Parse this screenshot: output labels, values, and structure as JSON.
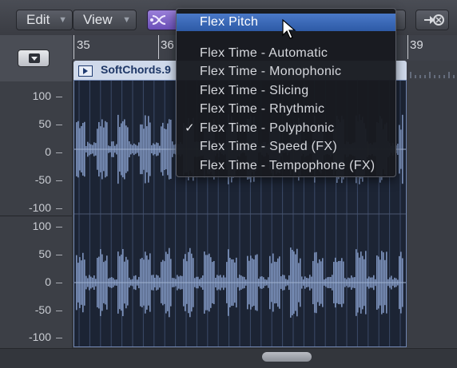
{
  "toolbar": {
    "edit_label": "Edit",
    "view_label": "View",
    "menu_arrow": "▼"
  },
  "ruler": {
    "bars": [
      "35",
      "36",
      "39"
    ]
  },
  "region": {
    "name": "SoftChords.9"
  },
  "yaxis_top": [
    "100",
    "50",
    "0",
    "-50",
    "-100"
  ],
  "yaxis_bottom": [
    "100",
    "50",
    "0",
    "-50",
    "-100"
  ],
  "flex_menu": {
    "items": [
      {
        "label": "Flex Pitch",
        "selected": true,
        "checked": false
      },
      {
        "label": "Flex Time - Automatic",
        "selected": false,
        "checked": false
      },
      {
        "label": "Flex Time - Monophonic",
        "selected": false,
        "checked": false
      },
      {
        "label": "Flex Time - Slicing",
        "selected": false,
        "checked": false
      },
      {
        "label": "Flex Time - Rhythmic",
        "selected": false,
        "checked": false
      },
      {
        "label": "Flex Time - Polyphonic",
        "selected": false,
        "checked": true
      },
      {
        "label": "Flex Time - Speed (FX)",
        "selected": false,
        "checked": false
      },
      {
        "label": "Flex Time - Tempophone (FX)",
        "selected": false,
        "checked": false
      }
    ],
    "check_glyph": "✓"
  },
  "colors": {
    "menu_highlight": "#3d6cbd",
    "flex_button": "#8a6fd0",
    "region_header": "#cfd9ea",
    "waveform": "#7d93bd",
    "region_background": "#1c2434"
  },
  "icons": [
    "flex-icon",
    "catch-playhead-icon",
    "disclosure-icon",
    "audio-region-icon",
    "pointer-cursor-icon"
  ]
}
